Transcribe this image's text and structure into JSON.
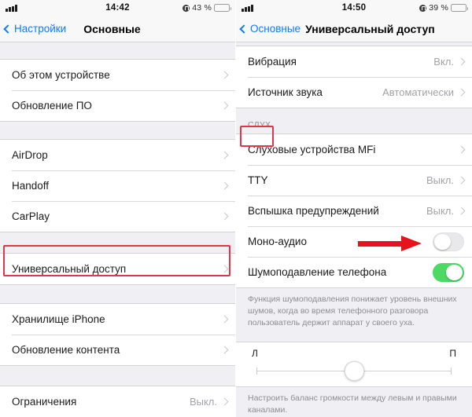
{
  "left": {
    "status": {
      "time": "14:42",
      "battery_pct": "43 %",
      "battery_level": 43,
      "lock_icon": "lock-icon",
      "signal_icon": "signal-bars-icon"
    },
    "nav": {
      "back_label": "Настройки",
      "title": "Основные"
    },
    "groups": [
      {
        "rows": [
          {
            "label": "Об этом устройстве",
            "value": "",
            "chevron": true
          },
          {
            "label": "Обновление ПО",
            "value": "",
            "chevron": true
          }
        ]
      },
      {
        "rows": [
          {
            "label": "AirDrop",
            "value": "",
            "chevron": true
          },
          {
            "label": "Handoff",
            "value": "",
            "chevron": true
          },
          {
            "label": "CarPlay",
            "value": "",
            "chevron": true
          }
        ]
      },
      {
        "rows": [
          {
            "label": "Универсальный доступ",
            "value": "",
            "chevron": true
          }
        ]
      },
      {
        "rows": [
          {
            "label": "Хранилище iPhone",
            "value": "",
            "chevron": true
          },
          {
            "label": "Обновление контента",
            "value": "",
            "chevron": true
          }
        ]
      },
      {
        "rows": [
          {
            "label": "Ограничения",
            "value": "Выкл.",
            "chevron": true
          }
        ]
      }
    ]
  },
  "right": {
    "status": {
      "time": "14:50",
      "battery_pct": "39 %",
      "battery_level": 39,
      "lock_icon": "lock-icon",
      "signal_icon": "signal-bars-icon"
    },
    "nav": {
      "back_label": "Основные",
      "title": "Универсальный доступ"
    },
    "rows_top": [
      {
        "label": "Вибрация",
        "value": "Вкл.",
        "chevron": true
      },
      {
        "label": "Источник звука",
        "value": "Автоматически",
        "chevron": true
      }
    ],
    "section_hearing": "СЛУХ",
    "rows_hearing": [
      {
        "label": "Слуховые устройства MFi",
        "value": "",
        "chevron": true
      },
      {
        "label": "TTY",
        "value": "Выкл.",
        "chevron": true
      },
      {
        "label": "Вспышка предупреждений",
        "value": "Выкл.",
        "chevron": true
      }
    ],
    "toggle_mono": {
      "label": "Моно-аудио",
      "state": "off"
    },
    "toggle_noise": {
      "label": "Шумоподавление телефона",
      "state": "on"
    },
    "footnote_noise": "Функция шумоподавления понижает уровень внешних шумов, когда во время телефонного разговора пользователь держит аппарат у своего уха.",
    "balance": {
      "left_label": "Л",
      "right_label": "П",
      "position_pct": 50
    },
    "footnote_balance": "Настроить баланс громкости между левым и правыми каналами."
  },
  "annotations": {
    "accent_color": "#e0354a",
    "arrow_color": "#e8121c",
    "highlight_accessibility_row": "Универсальный доступ",
    "highlight_hearing_header": "СЛУХ",
    "arrow_points_to": "Моно-аудио toggle"
  }
}
